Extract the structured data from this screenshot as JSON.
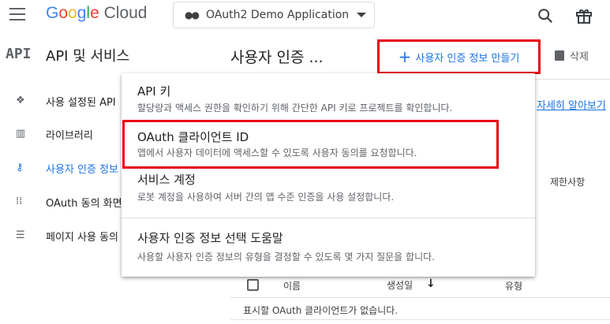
{
  "topbar": {
    "logo_google": [
      "G",
      "o",
      "o",
      "g",
      "l",
      "e"
    ],
    "logo_cloud": "Cloud",
    "project_name": "OAuth2 Demo Application"
  },
  "sidebar": {
    "badge": "API",
    "title": "API 및 서비스",
    "items": [
      {
        "label": "사용 설정된 API",
        "icon": "diamond-grid-icon",
        "active": false
      },
      {
        "label": "라이브러리",
        "icon": "library-icon",
        "active": false
      },
      {
        "label": "사용자 인증 정보",
        "icon": "key-icon",
        "active": true
      },
      {
        "label": "OAuth 동의 화면",
        "icon": "consent-dots-icon",
        "active": false
      },
      {
        "label": "페이지 사용 동의",
        "icon": "settings-list-icon",
        "active": false
      }
    ]
  },
  "header": {
    "title": "사용자 인증 ...",
    "create_label": "사용자 인증 정보 만들기",
    "delete_label": "삭제"
  },
  "background": {
    "learn_more": "자세히 알아보기",
    "restrictions_col": "제한사항"
  },
  "table": {
    "col_name": "이름",
    "col_created": "생성일",
    "col_type": "유형",
    "empty_msg": "표시할 OAuth 클라이언트가 없습니다."
  },
  "menu": {
    "items": [
      {
        "title": "API 키",
        "desc": "할당량과 액세스 권한을 확인하기 위해 간단한 API 키로 프로젝트를 확인합니다."
      },
      {
        "title": "OAuth 클라이언트 ID",
        "desc": "앱에서 사용자 데이터에 액세스할 수 있도록 사용자 동의를 요청합니다."
      },
      {
        "title": "서비스 계정",
        "desc": "로봇 계정을 사용하여 서버 간의 앱 수준 인증을 사용 설정합니다."
      },
      {
        "title": "사용자 인증 정보 선택 도움말",
        "desc": "사용할 사용자 인증 정보의 유형을 결정할 수 있도록 몇 가지 질문을 합니다."
      }
    ]
  },
  "colors": {
    "accent": "#1a73e8",
    "highlight": "#e60012"
  }
}
